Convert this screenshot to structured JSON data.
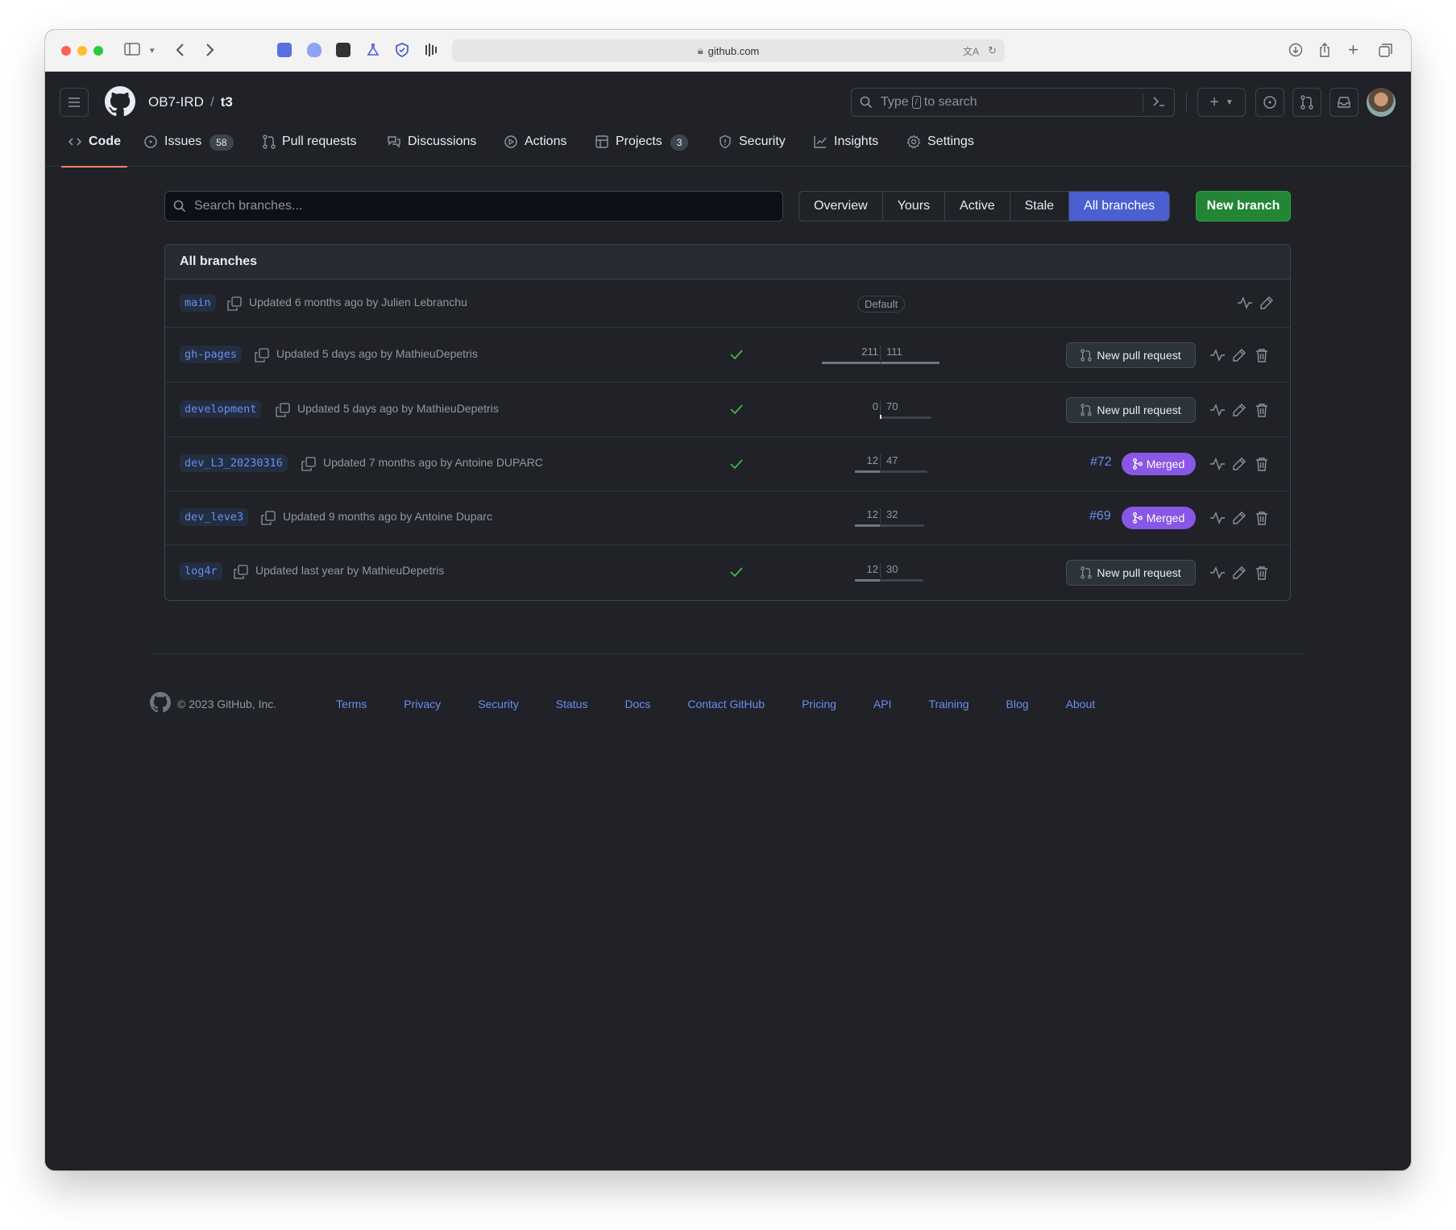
{
  "browser": {
    "url": "github.com"
  },
  "header": {
    "owner": "OB7-IRD",
    "separator": "/",
    "repo": "t3",
    "search_prefix": "Type",
    "search_key": "/",
    "search_suffix": "to search"
  },
  "nav": {
    "tabs": [
      {
        "label": "Code",
        "active": true
      },
      {
        "label": "Issues",
        "count": "58"
      },
      {
        "label": "Pull requests"
      },
      {
        "label": "Discussions"
      },
      {
        "label": "Actions"
      },
      {
        "label": "Projects",
        "count": "3"
      },
      {
        "label": "Security"
      },
      {
        "label": "Insights"
      },
      {
        "label": "Settings"
      }
    ]
  },
  "toolbar": {
    "search_placeholder": "Search branches...",
    "filters": [
      "Overview",
      "Yours",
      "Active",
      "Stale",
      "All branches"
    ],
    "active_filter": "All branches",
    "new_branch": "New branch"
  },
  "branches": {
    "title": "All branches",
    "rows": [
      {
        "name": "main",
        "updated": "Updated 6 months ago by Julien Lebranchu",
        "default": "Default"
      },
      {
        "name": "gh-pages",
        "updated": "Updated 5 days ago by MathieuDepetris",
        "check": true,
        "behind": "211",
        "ahead": "111",
        "action": "New pull request"
      },
      {
        "name": "development",
        "updated": "Updated 5 days ago by MathieuDepetris",
        "check": true,
        "behind": "0",
        "ahead": "70",
        "action": "New pull request"
      },
      {
        "name": "dev_L3_20230316",
        "updated": "Updated 7 months ago by Antoine DUPARC",
        "check": true,
        "behind": "12",
        "ahead": "47",
        "pr": "#72",
        "merged": "Merged"
      },
      {
        "name": "dev_leve3",
        "updated": "Updated 9 months ago by Antoine Duparc",
        "behind": "12",
        "ahead": "32",
        "pr": "#69",
        "merged": "Merged"
      },
      {
        "name": "log4r",
        "updated": "Updated last year by MathieuDepetris",
        "check": true,
        "behind": "12",
        "ahead": "30",
        "action": "New pull request"
      }
    ]
  },
  "footer": {
    "copyright": "© 2023 GitHub, Inc.",
    "links": [
      "Terms",
      "Privacy",
      "Security",
      "Status",
      "Docs",
      "Contact GitHub",
      "Pricing",
      "API",
      "Training",
      "Blog",
      "About"
    ]
  },
  "colors": {
    "background": "#202227",
    "accent_blue": "#4b5fd1",
    "new_branch_green": "#238636",
    "merged_purple": "#8957e5",
    "check_green": "#3fb950",
    "link_blue": "#6a8ef0",
    "active_tab_underline": "#f78166"
  }
}
